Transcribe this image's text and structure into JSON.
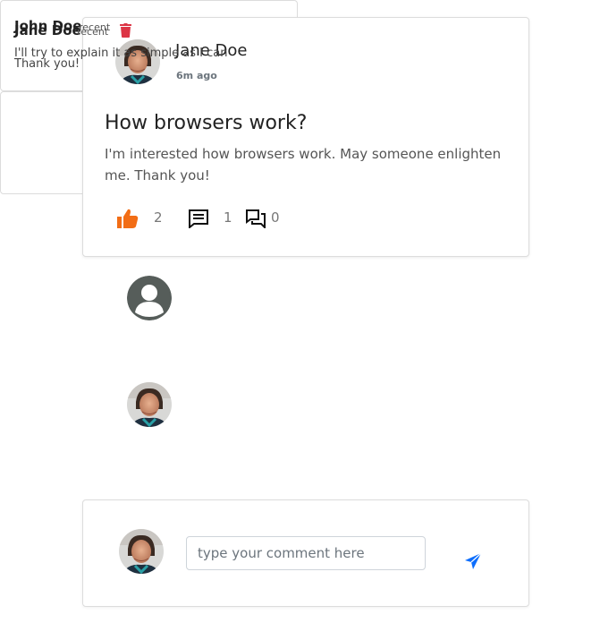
{
  "post": {
    "author": "Jane Doe",
    "time": "6m ago",
    "title": "How browsers work?",
    "body": "I'm interested how browsers work. May someone enlighten me. Thank you!",
    "likes": "2",
    "comments": "1",
    "discussions": "0"
  },
  "comments": [
    {
      "name": "John Doe",
      "time": "recent",
      "text": "I'll try to explain it as simple as I can"
    },
    {
      "name": "Jane Doe",
      "time": "recent",
      "text": "Thank you!"
    }
  ],
  "compose": {
    "placeholder": "type your comment here"
  },
  "colors": {
    "like": "#f26d15",
    "delete": "#dc3545",
    "send": "#0d6efd"
  },
  "icons": [
    "thumbs-up-icon",
    "comment-icon",
    "forum-icon",
    "trash-icon",
    "send-icon"
  ]
}
